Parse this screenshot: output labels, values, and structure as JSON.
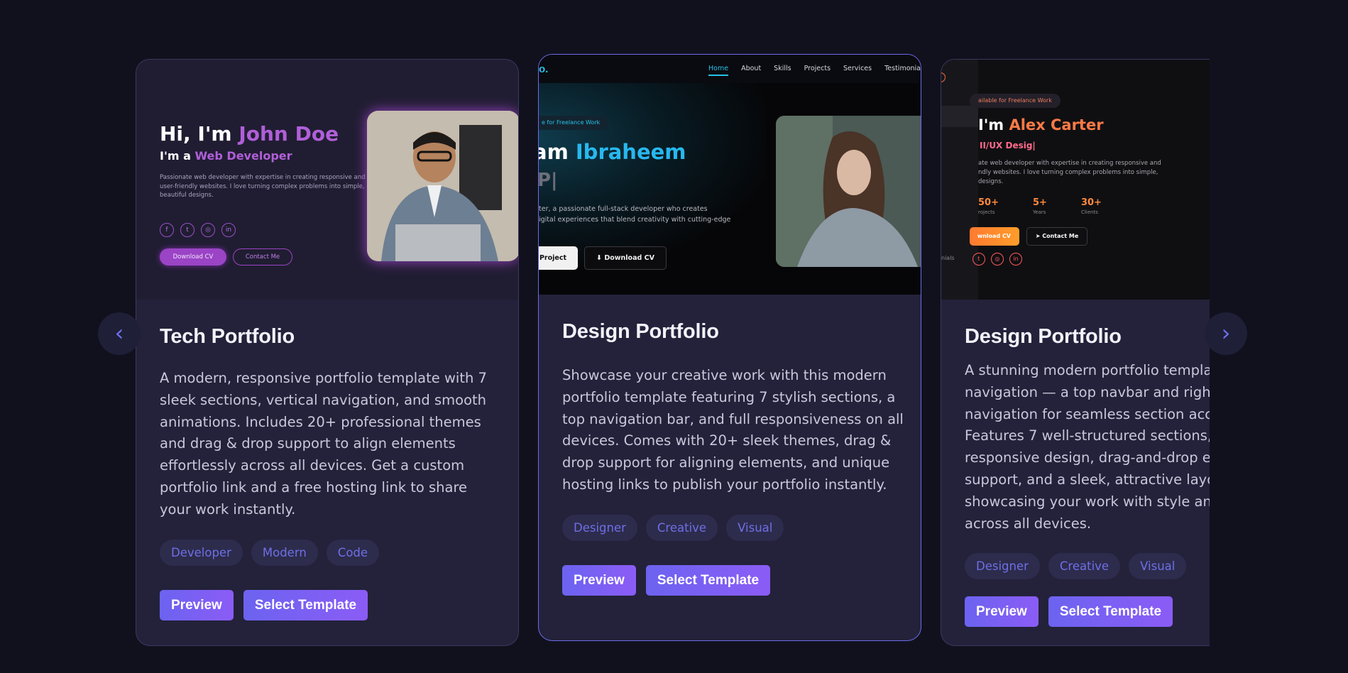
{
  "nav": {
    "prev_glyph": "‹",
    "next_glyph": "›"
  },
  "colors": {
    "background": "#11111e",
    "card": "#23223a",
    "accent": "#6c63f0",
    "tag_text": "#6f6fe6"
  },
  "cards": [
    {
      "title": "Tech Portfolio",
      "description": [
        "A modern, responsive portfolio template with 7",
        "sleek sections, vertical navigation, and smooth",
        "animations. Includes 20+ professional themes",
        "and drag & drop support to align elements",
        "effortlessly across all devices. Get a custom",
        "portfolio link and a free hosting link to share",
        "your work instantly."
      ],
      "tags": [
        "Developer",
        "Modern",
        "Code"
      ],
      "preview_label": "Preview",
      "select_label": "Select Template",
      "thumb": {
        "hi": "Hi, I'm ",
        "name": "John Doe",
        "role_prefix": "I'm a ",
        "role": "Web Developer",
        "bio": "Passionate web developer with expertise in creating responsive and user-friendly websites. I love turning complex problems into simple, beautiful designs.",
        "social_icons": [
          "facebook-icon",
          "twitter-icon",
          "instagram-icon",
          "linkedin-icon"
        ],
        "download_label": "Download CV",
        "contact_label": "Contact Me"
      }
    },
    {
      "title": "Design Portfolio",
      "description": [
        "Showcase your creative work with this modern",
        "portfolio template featuring 7 stylish sections, a",
        "top navigation bar, and full responsiveness on all",
        "devices. Comes with 20+ sleek themes, drag &",
        "drop support for aligning elements, and unique",
        "hosting links to publish your portfolio instantly."
      ],
      "tags": [
        "Designer",
        "Creative",
        "Visual"
      ],
      "preview_label": "Preview",
      "select_label": "Select Template",
      "thumb": {
        "logo": "o.",
        "nav_links": [
          "Home",
          "About",
          "Skills",
          "Projects",
          "Services",
          "Testimonia"
        ],
        "badge": "e for Freelance Work",
        "hi": "am ",
        "name": "Ibraheem",
        "role": "P|",
        "bio_lines": [
          "ter, a passionate full-stack developer who creates",
          "igital experiences that blend creativity with cutting-edge"
        ],
        "project_label": "t Project",
        "download_label": "Download CV"
      }
    },
    {
      "title": "Design Portfolio",
      "description": [
        "A stunning modern portfolio templat",
        "navigation — a top navbar and right",
        "navigation for seamless section acc",
        "Features 7 well-structured sections,",
        "responsive design, drag-and-drop e",
        "support, and a sleek, attractive layo",
        "showcasing your work with style an",
        "across all devices."
      ],
      "tags": [
        "Designer",
        "Creative",
        "Visual"
      ],
      "preview_label": "Preview",
      "select_label": "Select Template",
      "thumb": {
        "badge": "ailable for Freelance Work",
        "hi": "I'm ",
        "name": "Alex Carter",
        "role": "II/UX Desig|",
        "bio_lines": [
          "ate web developer with expertise in creating responsive and",
          "ndly websites. I love turning complex problems into simple,",
          " designs."
        ],
        "stats": [
          {
            "n": "50+",
            "l": "rojects"
          },
          {
            "n": "5+",
            "l": "Years"
          },
          {
            "n": "30+",
            "l": "Clients"
          }
        ],
        "download_label": "wnload CV",
        "contact_label": "Contact Me",
        "side_label": "nials"
      }
    }
  ]
}
